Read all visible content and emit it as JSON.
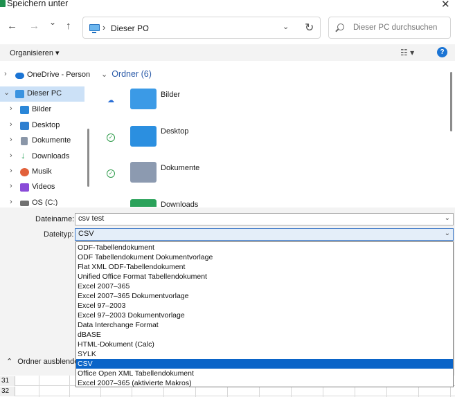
{
  "window": {
    "title": "Speichern unter",
    "close_glyph": "✕"
  },
  "nav": {
    "back_glyph": "←",
    "forward_glyph": "→",
    "recent_glyph": "⌄",
    "up_glyph": "↑",
    "breadcrumb": "Dieser PC",
    "sep_glyph": "›",
    "dropdown_glyph": "⌄",
    "refresh_glyph": "↻",
    "search_placeholder": "Dieser PC durchsuchen"
  },
  "toolbar": {
    "organize_label": "Organisieren ▾",
    "view_glyph": "☷ ▾",
    "help_glyph": "?"
  },
  "sidebar": {
    "items": [
      {
        "label": "OneDrive - Person",
        "icon": "cloud-icon",
        "color": "#1b74d4"
      },
      {
        "label": "Dieser PC",
        "icon": "computer-icon",
        "color": "#3a93e0"
      },
      {
        "label": "Bilder",
        "icon": "pictures-icon",
        "color": "#2a86d8"
      },
      {
        "label": "Desktop",
        "icon": "desktop-icon",
        "color": "#2f7fd0"
      },
      {
        "label": "Dokumente",
        "icon": "documents-icon",
        "color": "#8a96a8"
      },
      {
        "label": "Downloads",
        "icon": "download-icon",
        "color": "#2aa25a"
      },
      {
        "label": "Musik",
        "icon": "music-icon",
        "color": "#e2613b"
      },
      {
        "label": "Videos",
        "icon": "videos-icon",
        "color": "#8a4bd8"
      },
      {
        "label": "OS (C:)",
        "icon": "drive-icon",
        "color": "#707070"
      }
    ]
  },
  "content": {
    "group_label": "Ordner (6)",
    "group_chevron": "⌄",
    "folders": [
      {
        "name": "Bilder",
        "status": "☁",
        "color": "#3b9ae6"
      },
      {
        "name": "Desktop",
        "status": "✓",
        "color": "#2b8fe0"
      },
      {
        "name": "Dokumente",
        "status": "✓",
        "color": "#8c9ab0"
      },
      {
        "name": "Downloads",
        "status": "",
        "color": "#2aa25a"
      }
    ]
  },
  "form": {
    "filename_label": "Dateiname:",
    "filename_value": "csv test",
    "filetype_label": "Dateityp:",
    "filetype_value": "CSV",
    "dropdown_glyph": "⌄",
    "hide_folders_label": "Ordner ausblenden",
    "hide_folders_glyph": "⌃"
  },
  "filetype_options": [
    "ODF-Tabellendokument",
    "ODF Tabellendokument Dokumentvorlage",
    "Flat XML ODF-Tabellendokument",
    "Unified Office Format Tabellendokument",
    "Excel 2007–365",
    "Excel 2007–365 Dokumentvorlage",
    "Excel 97–2003",
    "Excel 97–2003 Dokumentvorlage",
    "Data Interchange Format",
    "dBASE",
    "HTML-Dokument (Calc)",
    "SYLK",
    "CSV",
    "Office Open XML Tabellendokument",
    "Excel 2007–365 (aktivierte Makros)"
  ],
  "selected_option_index": 12,
  "spreadsheet": {
    "row_numbers": [
      "31",
      "32"
    ]
  }
}
